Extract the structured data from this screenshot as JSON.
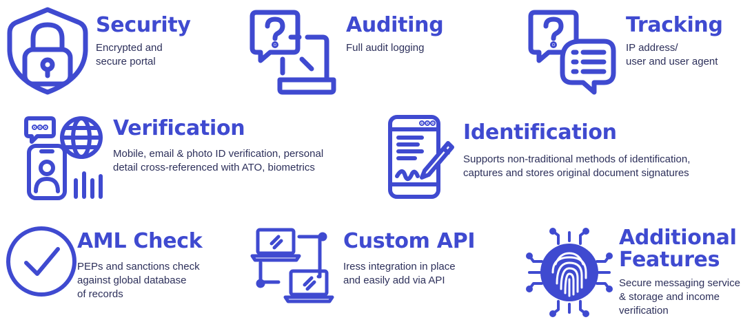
{
  "accent_color": "#3f4ad0",
  "features": {
    "security": {
      "icon": "shield-lock-icon",
      "title": "Security",
      "desc": [
        "Encrypted and",
        "secure portal"
      ]
    },
    "auditing": {
      "icon": "question-laptop-icon",
      "title": "Auditing",
      "desc": [
        "Full audit logging"
      ]
    },
    "tracking": {
      "icon": "chat-bubbles-icon",
      "title": "Tracking",
      "desc": [
        "IP address/",
        "user and user agent"
      ]
    },
    "verification": {
      "icon": "phone-globe-user-icon",
      "title": "Verification",
      "desc": [
        "Mobile, email & photo ID verification, personal",
        "detail cross-referenced with ATO, biometrics"
      ]
    },
    "identification": {
      "icon": "tablet-signature-icon",
      "title": "Identification",
      "desc": [
        "Supports non-traditional methods of identification,",
        "captures and stores original document signatures"
      ]
    },
    "aml": {
      "icon": "check-circle-icon",
      "title": "AML Check",
      "desc": [
        "PEPs and sanctions check",
        "against global database",
        "of records"
      ]
    },
    "api": {
      "icon": "connected-laptops-icon",
      "title": "Custom API",
      "desc": [
        "Iress integration in place",
        "and easily add via API"
      ]
    },
    "additional": {
      "icon": "fingerprint-chip-icon",
      "title": [
        "Additional",
        "Features"
      ],
      "desc": [
        "Secure messaging service",
        "& storage and  income",
        "verification"
      ]
    }
  }
}
